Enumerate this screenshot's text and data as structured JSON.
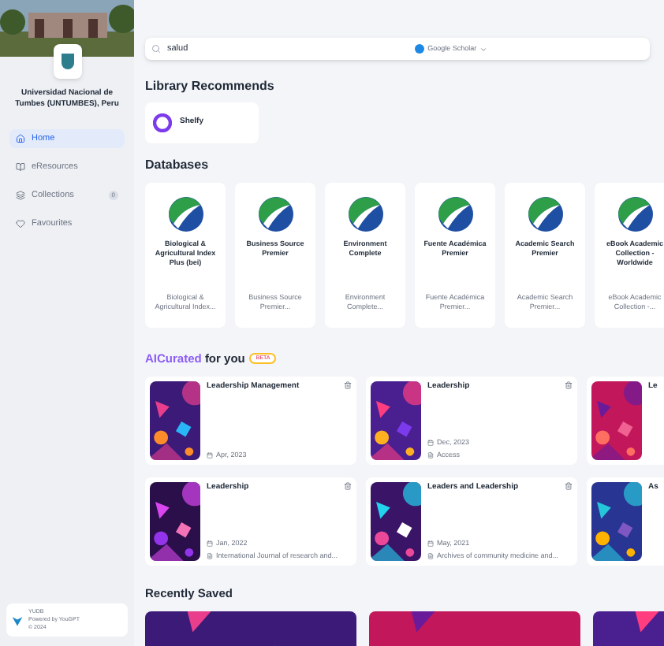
{
  "sidebar": {
    "institution": "Universidad Nacional de Tumbes (UNTUMBES), Peru",
    "items": [
      {
        "label": "Home",
        "selected": true
      },
      {
        "label": "eResources",
        "selected": false
      },
      {
        "label": "Collections",
        "selected": false,
        "badge": "0"
      },
      {
        "label": "Favourites",
        "selected": false
      }
    ],
    "footer": {
      "name": "YUDB",
      "powered": "Powered by YouGPT",
      "copyright": "© 2024"
    }
  },
  "search": {
    "value": "salud",
    "source": "Google Scholar"
  },
  "library_recommends": {
    "title": "Library Recommends",
    "items": [
      {
        "name": "Shelfy"
      }
    ]
  },
  "databases": {
    "title": "Databases",
    "items": [
      {
        "name": "Biological & Agricultural Index Plus (bei)",
        "subtitle": "Biological & Agricultural Index..."
      },
      {
        "name": "Business Source Premier",
        "subtitle": "Business Source Premier..."
      },
      {
        "name": "Environment Complete",
        "subtitle": "Environment Complete..."
      },
      {
        "name": "Fuente Académica Premier",
        "subtitle": "Fuente Académica Premier..."
      },
      {
        "name": "Academic Search Premier",
        "subtitle": "Academic Search Premier..."
      },
      {
        "name": "eBook Academic Collection - Worldwide",
        "subtitle": "eBook Academic Collection -..."
      }
    ]
  },
  "ai_curated": {
    "title_accent": "AICurated",
    "title_rest": "for you",
    "badge": "BETA",
    "items": [
      {
        "title": "Leadership Management",
        "date": "Apr, 2023"
      },
      {
        "title": "Leadership",
        "date": "Dec, 2023",
        "source": "Access"
      },
      {
        "title": "Le"
      },
      {
        "title": "Leadership",
        "date": "Jan, 2022",
        "source": "International Journal of research and..."
      },
      {
        "title": "Leaders and Leadership",
        "date": "May, 2021",
        "source": "Archives of community medicine and..."
      },
      {
        "title": "As"
      }
    ]
  },
  "recently_saved": {
    "title": "Recently Saved"
  }
}
